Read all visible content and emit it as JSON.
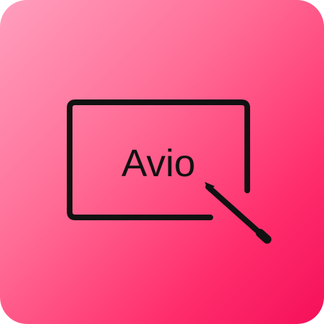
{
  "app_icon": {
    "logo_text": "Avio",
    "icon_name": "signature-pen-icon",
    "colors": {
      "gradient_start": "#ff9fbe",
      "gradient_end": "#f5105a",
      "stroke": "#111111"
    }
  }
}
